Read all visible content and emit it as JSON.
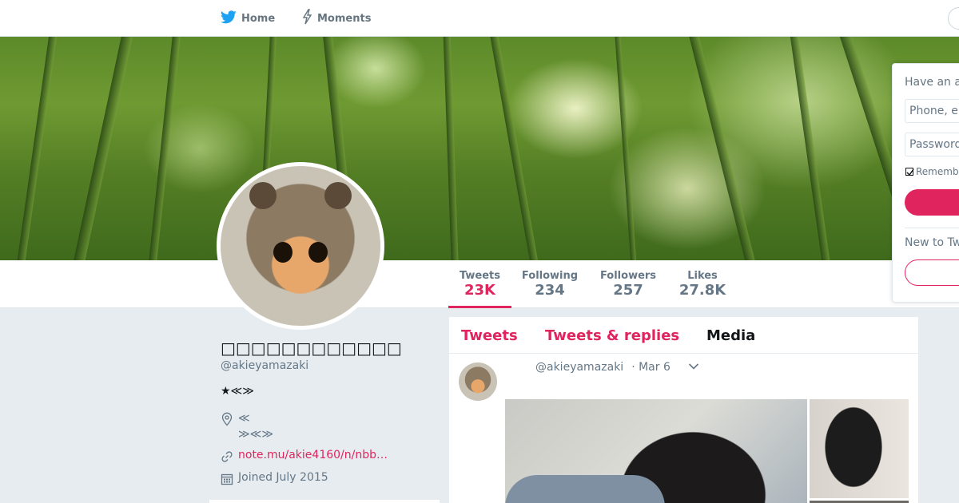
{
  "nav": {
    "home_label": "Home",
    "moments_label": "Moments"
  },
  "profile": {
    "name": "□□□□□□□□□□□□",
    "handle": "@akieyamazaki",
    "bio": "★≪≫",
    "location_line1": "≪",
    "location_line2": "≫≪≫",
    "url": "note.mu/akie4160/n/nbb…",
    "joined": "Joined July 2015"
  },
  "stats": [
    {
      "label": "Tweets",
      "value": "23K"
    },
    {
      "label": "Following",
      "value": "234"
    },
    {
      "label": "Followers",
      "value": "257"
    },
    {
      "label": "Likes",
      "value": "27.8K"
    }
  ],
  "timeline": {
    "tabs": [
      "Tweets",
      "Tweets & replies",
      "Media"
    ],
    "tweet": {
      "handle": "@akieyamazaki",
      "date": "· Mar 6"
    }
  },
  "login": {
    "heading": "Have an a",
    "phone_placeholder": "Phone, er",
    "password_placeholder": "Password",
    "remember": "Remembe",
    "new_to": "New to Tw"
  },
  "colors": {
    "accent": "#e0245e",
    "brand_bird": "#1da1f2",
    "muted_text": "#657786"
  },
  "icons": {
    "home": "twitter-bird-icon",
    "moments": "lightning-icon",
    "location": "location-pin-icon",
    "url": "link-icon",
    "joined": "calendar-icon",
    "caret": "chevron-down-icon"
  }
}
